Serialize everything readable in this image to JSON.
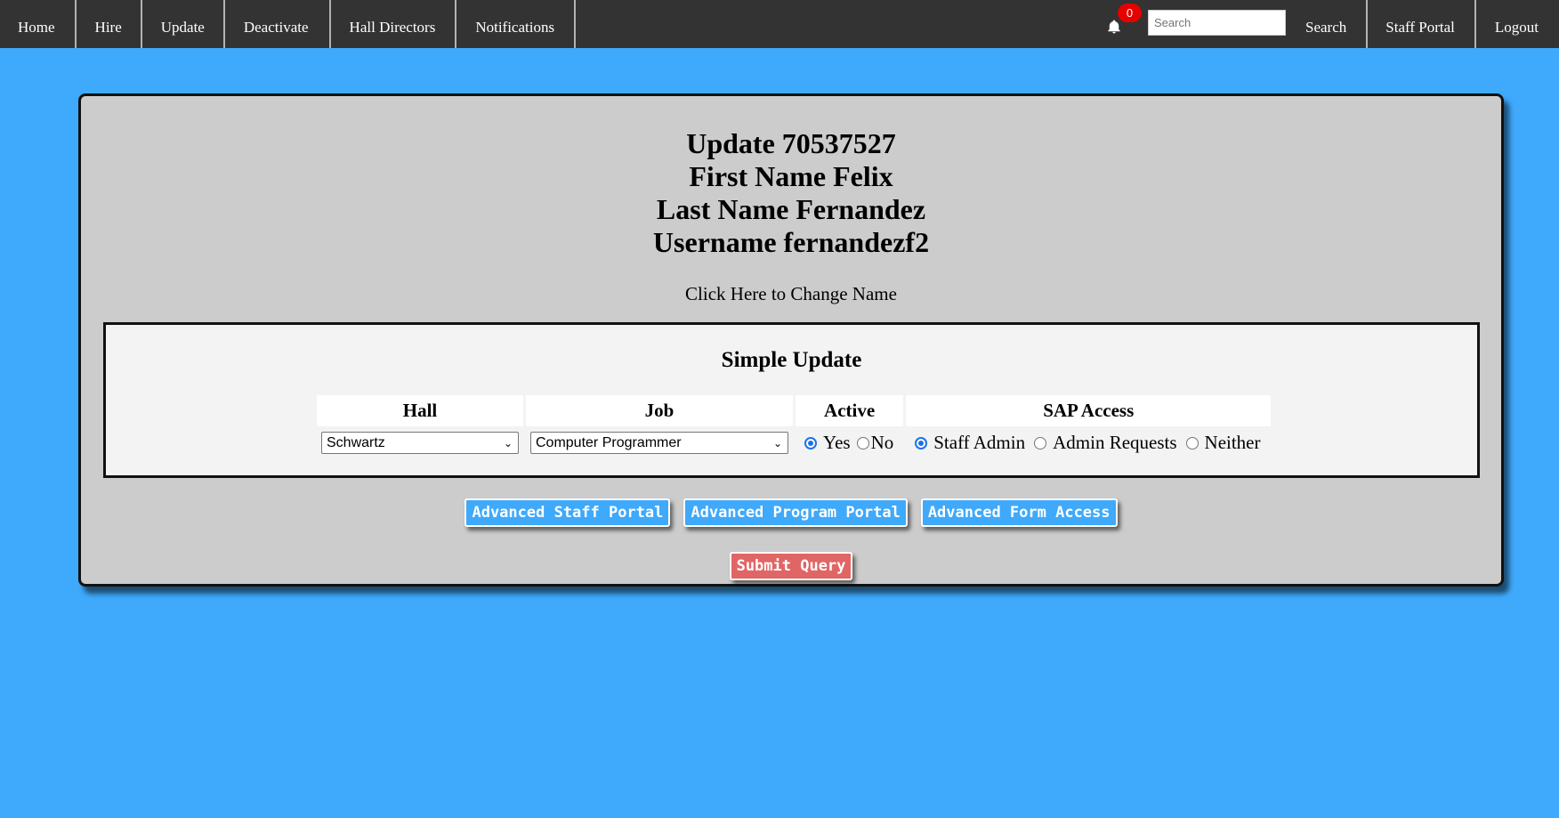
{
  "nav": {
    "left": [
      "Home",
      "Hire",
      "Update",
      "Deactivate",
      "Hall Directors",
      "Notifications"
    ],
    "notification_count": "0",
    "search_placeholder": "Search",
    "search_button": "Search",
    "staff_portal": "Staff Portal",
    "logout": "Logout"
  },
  "header": {
    "update_line": "Update 70537527",
    "first_name_line": "First Name Felix",
    "last_name_line": "Last Name Fernandez",
    "username_line": "Username fernandezf2",
    "change_name_link": "Click Here to Change Name"
  },
  "simple_update": {
    "title": "Simple Update",
    "columns": [
      "Hall",
      "Job",
      "Active",
      "SAP Access"
    ],
    "hall_value": "Schwartz",
    "job_value": "Computer Programmer",
    "active_options": [
      "Yes",
      "No"
    ],
    "active_selected": "Yes",
    "sap_options": [
      "Staff Admin",
      "Admin Requests",
      "Neither"
    ],
    "sap_selected": "Staff Admin"
  },
  "buttons": {
    "advanced_staff_portal": "Advanced Staff Portal",
    "advanced_program_portal": "Advanced Program Portal",
    "advanced_form_access": "Advanced Form Access",
    "submit": "Submit Query"
  },
  "colors": {
    "background": "#3fa9fb",
    "navbar": "#333333",
    "card": "#cccccc",
    "submit": "#e06666",
    "badge": "#e60000"
  }
}
